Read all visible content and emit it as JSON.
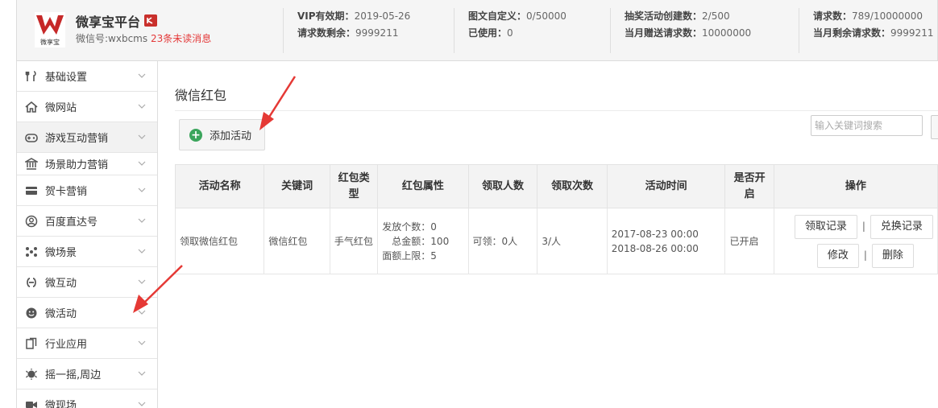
{
  "brand": {
    "name": "微享宝平台",
    "logo_text": "微享宝",
    "wechat_id": "微信号:wxbcms",
    "unread": "23条未读消息"
  },
  "stats": [
    {
      "line1_key": "VIP有效期：",
      "line1_val": "2019-05-26",
      "line2_key": "请求数剩余：",
      "line2_val": "9999211"
    },
    {
      "line1_key": "图文自定义：",
      "line1_val": "0/50000",
      "line2_key": "已使用：",
      "line2_val": "0"
    },
    {
      "line1_key": "抽奖活动创建数：",
      "line1_val": "2/500",
      "line2_key": "当月赠送请求数：",
      "line2_val": "10000000"
    },
    {
      "line1_key": "请求数：",
      "line1_val": "789/10000000",
      "line2_key": "当月剩余请求数：",
      "line2_val": "9999211"
    }
  ],
  "sidebar": {
    "items": [
      {
        "label": "基础设置",
        "icon": "tools-icon"
      },
      {
        "label": "微网站",
        "icon": "home-icon"
      },
      {
        "label": "游戏互动营销",
        "icon": "gamepad-icon"
      },
      {
        "label": "场景助力营销",
        "icon": "bank-icon"
      },
      {
        "label": "贺卡营销",
        "icon": "card-icon"
      },
      {
        "label": "百度直达号",
        "icon": "user-circle-icon"
      },
      {
        "label": "微场景",
        "icon": "nodes-icon"
      },
      {
        "label": "微互动",
        "icon": "links-icon"
      },
      {
        "label": "微活动",
        "icon": "smile-icon"
      },
      {
        "label": "行业应用",
        "icon": "copy-icon"
      },
      {
        "label": "摇一摇,周边",
        "icon": "shake-icon"
      },
      {
        "label": "微现场",
        "icon": "video-icon"
      }
    ]
  },
  "main": {
    "title": "微信红包",
    "add_label": "添加活动",
    "search_placeholder": "输入关键词搜索"
  },
  "table": {
    "headers": [
      "活动名称",
      "关键词",
      "红包类型",
      "红包属性",
      "领取人数",
      "领取次数",
      "活动时间",
      "是否开启",
      "操作"
    ],
    "rows": [
      {
        "name": "领取微信红包",
        "keyword": "微信红包",
        "type": "手气红包",
        "attr_line1": "发放个数：0",
        "attr_line2": "总金额：100",
        "attr_line3": "面额上限：5",
        "receivers": "可领：0人",
        "times": "3/人",
        "time_start": "2017-08-23 00:00",
        "time_end": "2018-08-26 00:00",
        "enabled": "已开启",
        "op_receive": "领取记录",
        "op_exchange": "兑换记录",
        "op_edit": "修改",
        "op_delete": "删除"
      }
    ]
  },
  "colors": {
    "accent_red": "#e43a3a",
    "add_green": "#3ba55c",
    "header_bg": "#f5f5f5"
  }
}
